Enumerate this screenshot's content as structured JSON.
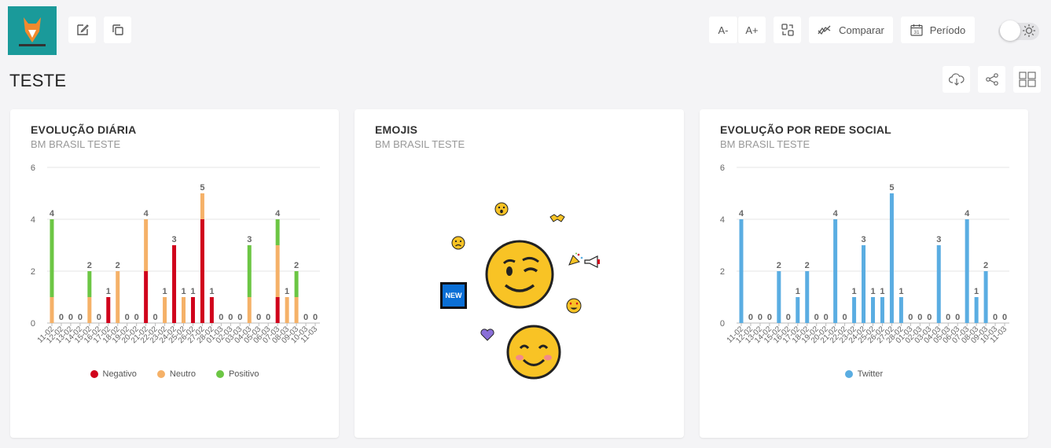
{
  "toolbar": {
    "font_decrease": "A-",
    "font_increase": "A+",
    "compare_label": "Comparar",
    "period_label": "Período",
    "calendar_day": "31"
  },
  "page": {
    "title": "TESTE"
  },
  "cards": {
    "daily": {
      "title": "EVOLUÇÃO DIÁRIA",
      "subtitle": "BM BRASIL TESTE"
    },
    "emojis": {
      "title": "EMOJIS",
      "subtitle": "BM BRASIL TESTE",
      "badge": "NEW"
    },
    "social": {
      "title": "EVOLUÇÃO POR REDE SOCIAL",
      "subtitle": "BM BRASIL TESTE"
    }
  },
  "colors": {
    "negativo": "#d0021b",
    "neutro": "#f5b168",
    "positivo": "#6cc644",
    "twitter": "#5aade2"
  },
  "chart_data": [
    {
      "type": "bar",
      "stacked": true,
      "categories": [
        "11-02",
        "12-02",
        "13-02",
        "14-02",
        "15-02",
        "16-02",
        "17-02",
        "18-02",
        "19-02",
        "20-02",
        "21-02",
        "22-02",
        "23-02",
        "24-02",
        "25-02",
        "26-02",
        "27-02",
        "28-02",
        "01-03",
        "02-03",
        "03-03",
        "04-03",
        "05-03",
        "06-03",
        "07-03",
        "08-03",
        "09-03",
        "10-03",
        "11-03"
      ],
      "ylim": [
        0,
        6
      ],
      "yticks": [
        0,
        2,
        4,
        6
      ],
      "series": [
        {
          "name": "Negativo",
          "values": [
            0,
            0,
            0,
            0,
            0,
            0,
            1,
            0,
            0,
            0,
            2,
            0,
            0,
            3,
            0,
            1,
            4,
            1,
            0,
            0,
            0,
            0,
            0,
            0,
            1,
            0,
            0,
            0,
            0
          ]
        },
        {
          "name": "Neutro",
          "values": [
            1,
            0,
            0,
            0,
            1,
            0,
            0,
            2,
            0,
            0,
            2,
            0,
            1,
            0,
            1,
            0,
            1,
            0,
            0,
            0,
            0,
            1,
            0,
            0,
            2,
            1,
            1,
            0,
            0
          ]
        },
        {
          "name": "Positivo",
          "values": [
            3,
            0,
            0,
            0,
            1,
            0,
            0,
            0,
            0,
            0,
            0,
            0,
            0,
            0,
            0,
            0,
            0,
            0,
            0,
            0,
            0,
            2,
            0,
            0,
            1,
            0,
            1,
            0,
            0
          ]
        }
      ],
      "totals": [
        4,
        0,
        0,
        0,
        2,
        0,
        1,
        2,
        0,
        0,
        4,
        0,
        1,
        3,
        1,
        1,
        5,
        1,
        0,
        0,
        0,
        3,
        0,
        0,
        4,
        1,
        2,
        0,
        0
      ],
      "legend": [
        "Negativo",
        "Neutro",
        "Positivo"
      ]
    },
    {
      "type": "bar",
      "categories": [
        "11-02",
        "12-02",
        "13-02",
        "14-02",
        "15-02",
        "16-02",
        "17-02",
        "18-02",
        "19-02",
        "20-02",
        "21-02",
        "22-02",
        "23-02",
        "24-02",
        "25-02",
        "26-02",
        "27-02",
        "28-02",
        "01-03",
        "02-03",
        "03-03",
        "04-03",
        "05-03",
        "06-03",
        "07-03",
        "08-03",
        "09-03",
        "10-03",
        "11-03"
      ],
      "ylim": [
        0,
        6
      ],
      "yticks": [
        0,
        2,
        4,
        6
      ],
      "series": [
        {
          "name": "Twitter",
          "values": [
            4,
            0,
            0,
            0,
            2,
            0,
            1,
            2,
            0,
            0,
            4,
            0,
            1,
            3,
            1,
            1,
            5,
            1,
            0,
            0,
            0,
            3,
            0,
            0,
            4,
            1,
            2,
            0,
            0
          ]
        }
      ],
      "legend": [
        "Twitter"
      ]
    }
  ]
}
